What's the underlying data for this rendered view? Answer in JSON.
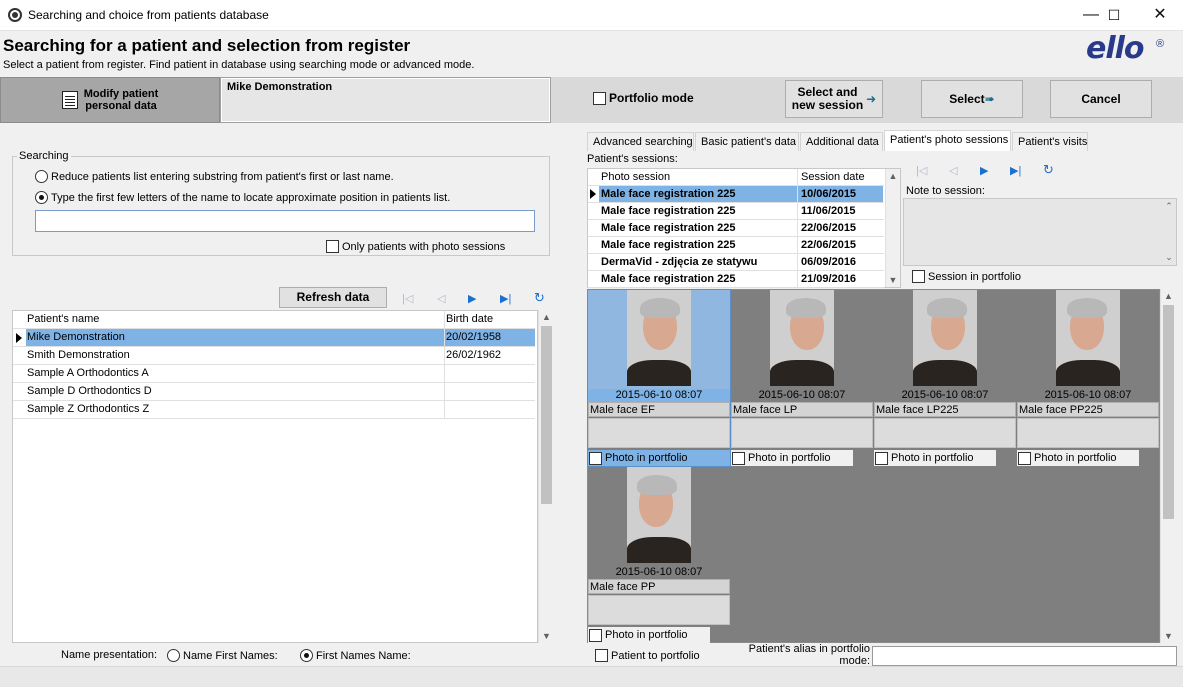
{
  "window": {
    "title": "Searching and choice from patients database",
    "minimize": "—",
    "maximize": "☐",
    "close": "✕"
  },
  "header": {
    "title": "Searching for a patient and selection from register",
    "subtitle": "Select a patient from register. Find patient in database using searching mode or advanced mode.",
    "logo": "ello",
    "logo_mark": "®"
  },
  "toolbar": {
    "modify_label": "Modify patient\npersonal data",
    "current_patient": "Mike Demonstration",
    "portfolio_mode_label": "Portfolio mode",
    "select_session_label": "Select and\nnew session",
    "select_label": "Select",
    "cancel_label": "Cancel"
  },
  "search": {
    "legend": "Searching",
    "option_reduce": "Reduce patients list entering substring from patient's first or last name.",
    "option_type": "Type the first few letters of the name to locate approximate position in patients list.",
    "input_value": "",
    "only_photo_sessions": "Only patients with photo sessions"
  },
  "patients": {
    "refresh_label": "Refresh data",
    "nav": {
      "first": "|◁",
      "prev": "◁",
      "next": "▶",
      "last": "▶|",
      "refresh": "↻"
    },
    "columns": [
      "Patient's name",
      "Birth date"
    ],
    "rows": [
      {
        "name": "Mike Demonstration",
        "birth": "20/02/1958"
      },
      {
        "name": "Smith Demonstration",
        "birth": "26/02/1962"
      },
      {
        "name": "Sample A Orthodontics A",
        "birth": ""
      },
      {
        "name": "Sample D Orthodontics D",
        "birth": ""
      },
      {
        "name": "Sample Z Orthodontics Z",
        "birth": ""
      }
    ]
  },
  "name_presentation": {
    "label": "Name presentation:",
    "option_a": "Name First Names:",
    "option_b": "First Names Name:"
  },
  "tabs": [
    "Advanced searching",
    "Basic patient's data",
    "Additional data",
    "Patient's photo sessions",
    "Patient's visits"
  ],
  "sessions": {
    "label": "Patient's sessions:",
    "columns": [
      "Photo session",
      "Session date"
    ],
    "rows": [
      {
        "name": "Male face registration 225",
        "date": "10/06/2015"
      },
      {
        "name": "Male face registration 225",
        "date": "11/06/2015"
      },
      {
        "name": "Male face registration 225",
        "date": "22/06/2015"
      },
      {
        "name": "Male face registration 225",
        "date": "22/06/2015"
      },
      {
        "name": "DermaVid - zdjęcia ze statywu",
        "date": "06/09/2016"
      },
      {
        "name": "Male face registration 225",
        "date": "21/09/2016"
      }
    ],
    "note_label": "Note to session:",
    "session_in_portfolio": "Session in portfolio"
  },
  "photos": [
    {
      "datetime": "2015-06-10 08:07",
      "name": "Male face EF",
      "portfolio": "Photo in portfolio"
    },
    {
      "datetime": "2015-06-10 08:07",
      "name": "Male face LP",
      "portfolio": "Photo in portfolio"
    },
    {
      "datetime": "2015-06-10 08:07",
      "name": "Male face LP225",
      "portfolio": "Photo in portfolio"
    },
    {
      "datetime": "2015-06-10 08:07",
      "name": "Male face PP225",
      "portfolio": "Photo in portfolio"
    },
    {
      "datetime": "2015-06-10 08:07",
      "name": "Male face PP",
      "portfolio": "Photo in portfolio"
    }
  ],
  "footer": {
    "patient_to_portfolio": "Patient to portfolio",
    "alias_label": "Patient's alias in portfolio\nmode:",
    "alias_value": ""
  }
}
